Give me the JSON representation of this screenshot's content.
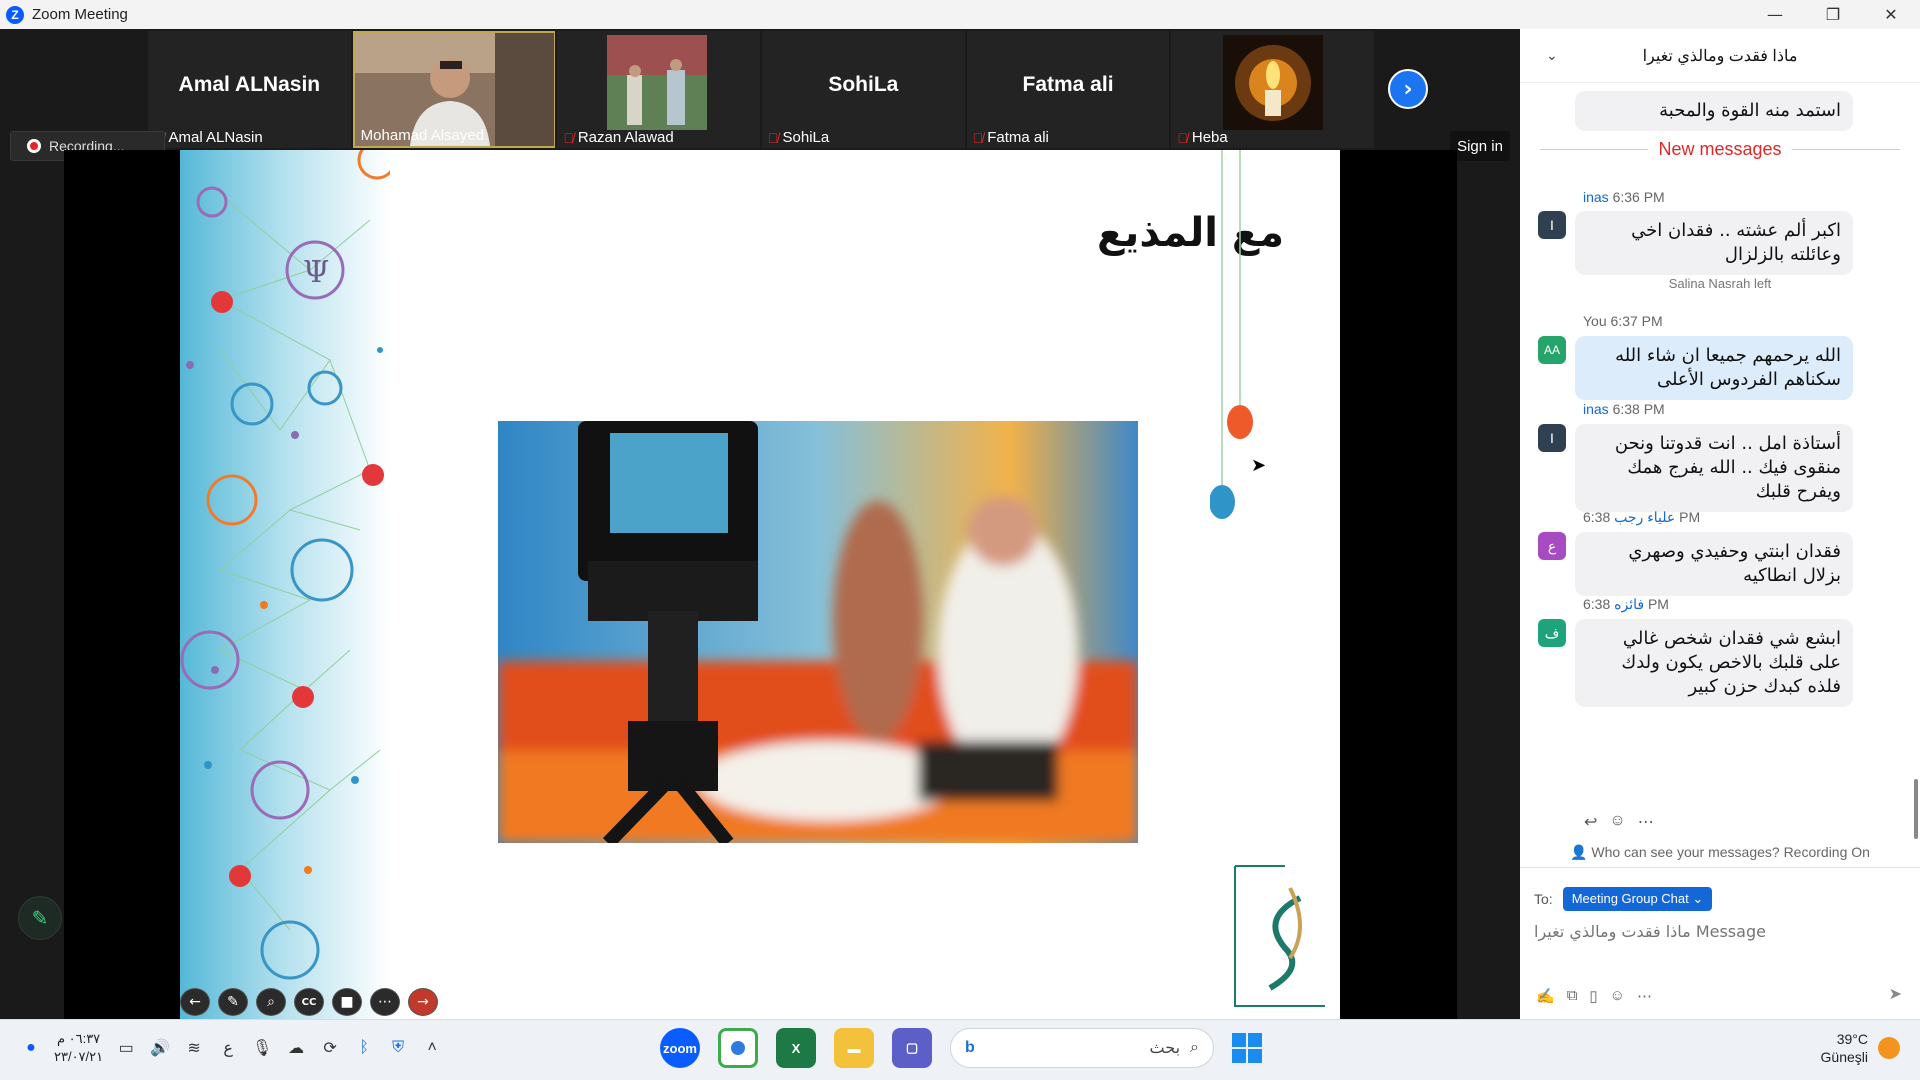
{
  "window": {
    "title": "Zoom Meeting",
    "controls": [
      "—",
      "❐",
      "✕"
    ]
  },
  "participants": [
    {
      "name": "Amal ALNasin",
      "label": "Amal ALNasin",
      "muted": true,
      "video": false
    },
    {
      "name": "Mohamad Alsayed",
      "label": "Mohamad Alsayed",
      "muted": false,
      "video": true,
      "active": true
    },
    {
      "name": "Razan Alawad",
      "label": "Razan Alawad",
      "muted": true,
      "video": true
    },
    {
      "name": "SohiLa",
      "label": "SohiLa",
      "muted": true,
      "video": false
    },
    {
      "name": "Fatma ali",
      "label": "Fatma ali",
      "muted": true,
      "video": false
    },
    {
      "name": "Heba",
      "label": "Heba",
      "muted": true,
      "video": true
    }
  ],
  "recording_label": "Recording...",
  "signin_label": "Sign in",
  "slide": {
    "title": "مع المذيع"
  },
  "slide_controls": [
    "back-icon",
    "pen-icon",
    "zoom-icon",
    "cc-icon",
    "camera-icon",
    "more-icon",
    "forward-icon"
  ],
  "chat": {
    "header": "ماذا فقدت ومالذي تغيرا",
    "prev_bubble": "استمد منه القوة والمحبة",
    "new_messages_label": "New messages",
    "messages": [
      {
        "sender": "inas",
        "time": "6:36 PM",
        "avatar": "I",
        "avatar_color": "#2f4050",
        "text": "اكبر ألم عشته .. فقدان اخي وعائلته بالزلزال",
        "mine": false
      },
      {
        "system": "Salina Nasrah left"
      },
      {
        "sender": "You",
        "time": "6:37 PM",
        "avatar": "AA",
        "avatar_color": "#25a56a",
        "text": "الله يرحمهم جميعا ان شاء الله سكناهم الفردوس الأعلى",
        "mine": true
      },
      {
        "sender": "inas",
        "time": "6:38 PM",
        "avatar": "I",
        "avatar_color": "#2f4050",
        "text": "أستاذة امل .. انت قدوتنا ونحن منقوى فيك .. الله يفرج همك ويفرح قلبك",
        "mine": false
      },
      {
        "sender": "علياء رجب",
        "time": "6:38 PM",
        "avatar": "ع",
        "avatar_color": "#a64bc1",
        "text": "فقدان ابنتي وحفيدي وصهري بزلال انطاكيه",
        "mine": false
      },
      {
        "sender": "فائزه",
        "time": "6:38 PM",
        "avatar": "ف",
        "avatar_color": "#1fa37a",
        "text": "ابشع شي فقدان شخص غالي على قلبك بالاخص يكون ولدك فلذه كبدك حزن كبير",
        "mine": false
      }
    ],
    "privacy_text": "Who can see your messages? Recording On",
    "to_label": "To:",
    "to_target": "Meeting Group Chat",
    "input_placeholder": "Message ماذا فقدت ومالذي تغيرا"
  },
  "taskbar": {
    "time": "٠٦:٣٧ م",
    "date": "٢٣/٠٧/٢١",
    "lang": "ع",
    "search_text": "بحث",
    "weather_temp": "39°C",
    "weather_text": "Güneşli"
  }
}
